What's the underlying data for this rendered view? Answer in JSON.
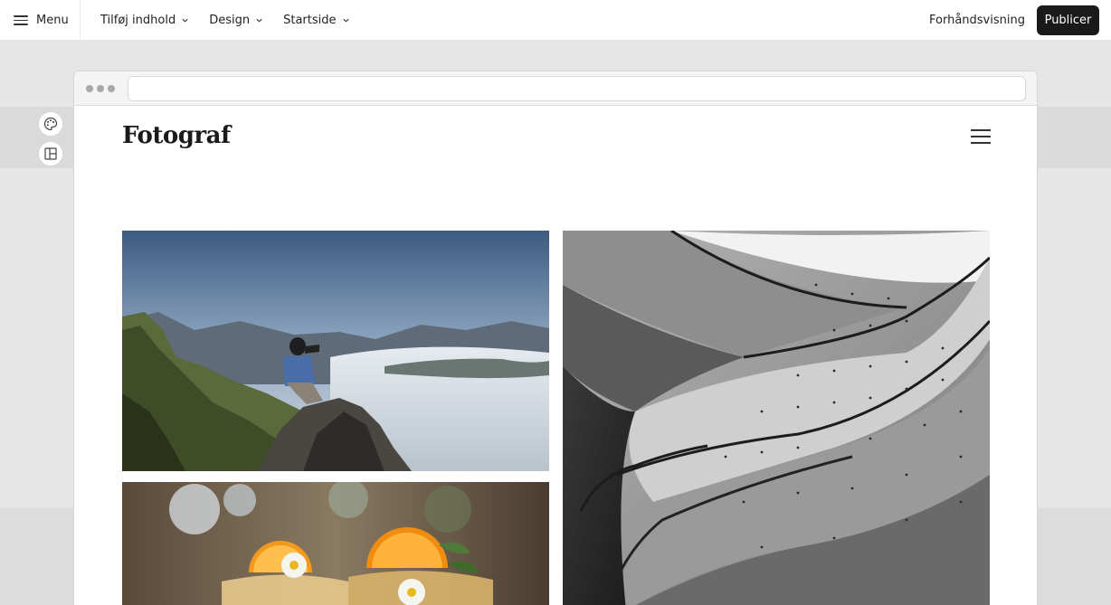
{
  "toolbar": {
    "menu_label": "Menu",
    "nav": [
      {
        "label": "Tilføj indhold"
      },
      {
        "label": "Design"
      },
      {
        "label": "Startside"
      }
    ],
    "preview_label": "Forhåndsvisning",
    "publish_label": "Publicer"
  },
  "site": {
    "logo": "Fotograf"
  },
  "side_tools": [
    {
      "icon": "palette-icon"
    },
    {
      "icon": "layout-icon"
    }
  ],
  "gallery": [
    {
      "subject": "photographer on mountain above clouds"
    },
    {
      "subject": "drinks with orange slices and daisies"
    },
    {
      "subject": "black and white concrete spiral staircase"
    }
  ],
  "colors": {
    "publish_bg": "#1a1a1a",
    "workspace_bg": "#e6e6e6"
  }
}
